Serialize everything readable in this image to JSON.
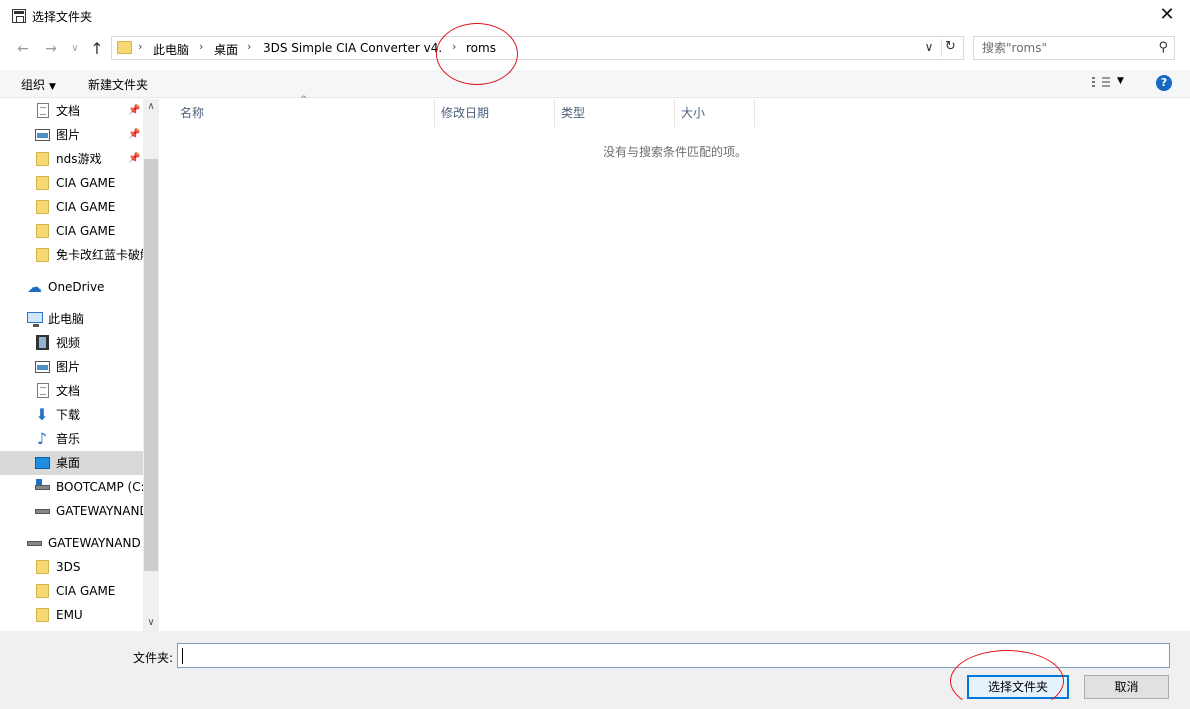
{
  "window": {
    "title": "选择文件夹",
    "close_glyph": "✕"
  },
  "nav": {
    "back_glyph": "←",
    "forward_glyph": "→",
    "recent_glyph": "∨",
    "up_glyph": "↑",
    "breadcrumb": [
      "此电脑",
      "桌面",
      "3DS Simple CIA Converter v4.3",
      "roms"
    ],
    "breadcrumb_sep": "›",
    "search_placeholder": "搜索\"roms\""
  },
  "toolbar": {
    "organize": "组织",
    "new_folder": "新建文件夹",
    "help": "?"
  },
  "sidebar": {
    "items": [
      {
        "label": "文档",
        "icon": "doc-icon",
        "pinned": true
      },
      {
        "label": "图片",
        "icon": "picture-icon",
        "pinned": true
      },
      {
        "label": "nds游戏",
        "icon": "folder-icon",
        "pinned": true
      },
      {
        "label": "CIA GAME",
        "icon": "folder-icon"
      },
      {
        "label": "CIA GAME",
        "icon": "folder-icon"
      },
      {
        "label": "CIA GAME",
        "icon": "folder-icon"
      },
      {
        "label": "免卡改红蓝卡破解",
        "icon": "folder-icon"
      },
      {
        "label": "OneDrive",
        "icon": "onedrive-icon"
      },
      {
        "label": "此电脑",
        "icon": "pc-icon"
      },
      {
        "label": "视频",
        "icon": "video-icon"
      },
      {
        "label": "图片",
        "icon": "picture-icon"
      },
      {
        "label": "文档",
        "icon": "doc-icon"
      },
      {
        "label": "下载",
        "icon": "download-icon"
      },
      {
        "label": "音乐",
        "icon": "music-icon"
      },
      {
        "label": "桌面",
        "icon": "desktop-icon",
        "selected": true
      },
      {
        "label": "BOOTCAMP (C:)",
        "icon": "drive-icon"
      },
      {
        "label": "GATEWAYNAND",
        "icon": "drive-icon"
      },
      {
        "label": "GATEWAYNAND",
        "icon": "drive-icon"
      },
      {
        "label": "3DS",
        "icon": "folder-icon"
      },
      {
        "label": "CIA GAME",
        "icon": "folder-icon"
      },
      {
        "label": "EMU",
        "icon": "folder-icon"
      }
    ]
  },
  "columns": [
    "名称",
    "修改日期",
    "类型",
    "大小"
  ],
  "empty_message": "没有与搜索条件匹配的项。",
  "bottom": {
    "folder_label": "文件夹:",
    "folder_value": "",
    "select_button": "选择文件夹",
    "cancel_button": "取消"
  },
  "colors": {
    "accent": "#0078d7",
    "annotation": "#e0131b",
    "help": "#1669c2"
  }
}
